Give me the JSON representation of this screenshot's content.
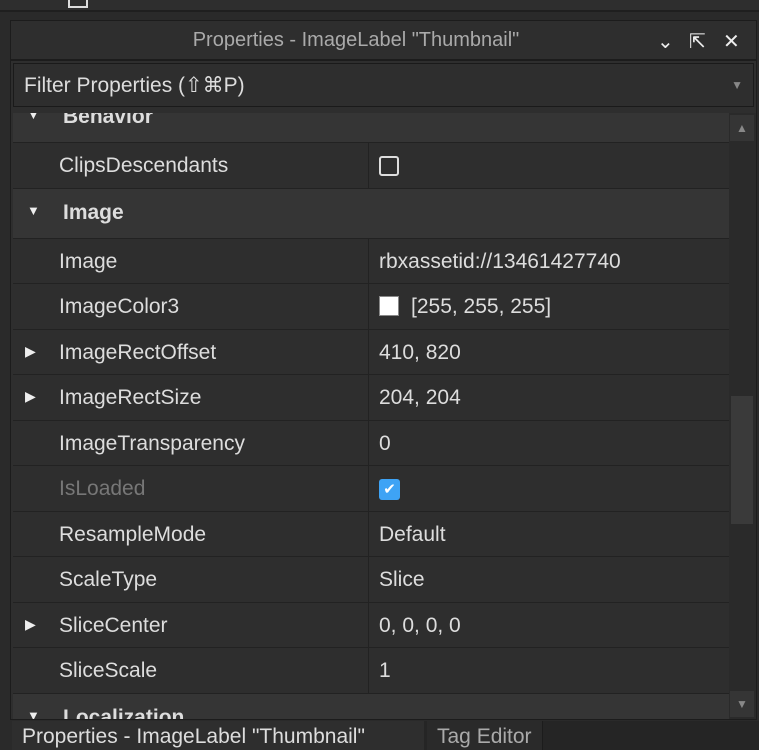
{
  "window": {
    "title": "Properties - ImageLabel \"Thumbnail\"",
    "collapse": "⌄",
    "dock": "⇱",
    "close": "✕"
  },
  "filter": {
    "placeholder": "Filter Properties (⇧⌘P)"
  },
  "sections": [
    {
      "label": "Behavior",
      "rows": [
        {
          "name": "ClipsDescendants",
          "type": "checkbox",
          "checked": false
        }
      ]
    },
    {
      "label": "Image",
      "rows": [
        {
          "name": "Image",
          "value": "rbxassetid://13461427740"
        },
        {
          "name": "ImageColor3",
          "value": "[255, 255, 255]",
          "color": "#ffffff"
        },
        {
          "name": "ImageRectOffset",
          "value": "410, 820",
          "expandable": true
        },
        {
          "name": "ImageRectSize",
          "value": "204, 204",
          "expandable": true
        },
        {
          "name": "ImageTransparency",
          "value": "0"
        },
        {
          "name": "IsLoaded",
          "type": "checkbox",
          "checked": true,
          "disabled": true
        },
        {
          "name": "ResampleMode",
          "value": "Default"
        },
        {
          "name": "ScaleType",
          "value": "Slice"
        },
        {
          "name": "SliceCenter",
          "value": "0, 0, 0, 0",
          "expandable": true
        },
        {
          "name": "SliceScale",
          "value": "1"
        }
      ]
    },
    {
      "label": "Localization",
      "rows": []
    }
  ],
  "tabs": [
    {
      "label": "Properties - ImageLabel \"Thumbnail\""
    },
    {
      "label": "Tag Editor"
    }
  ]
}
